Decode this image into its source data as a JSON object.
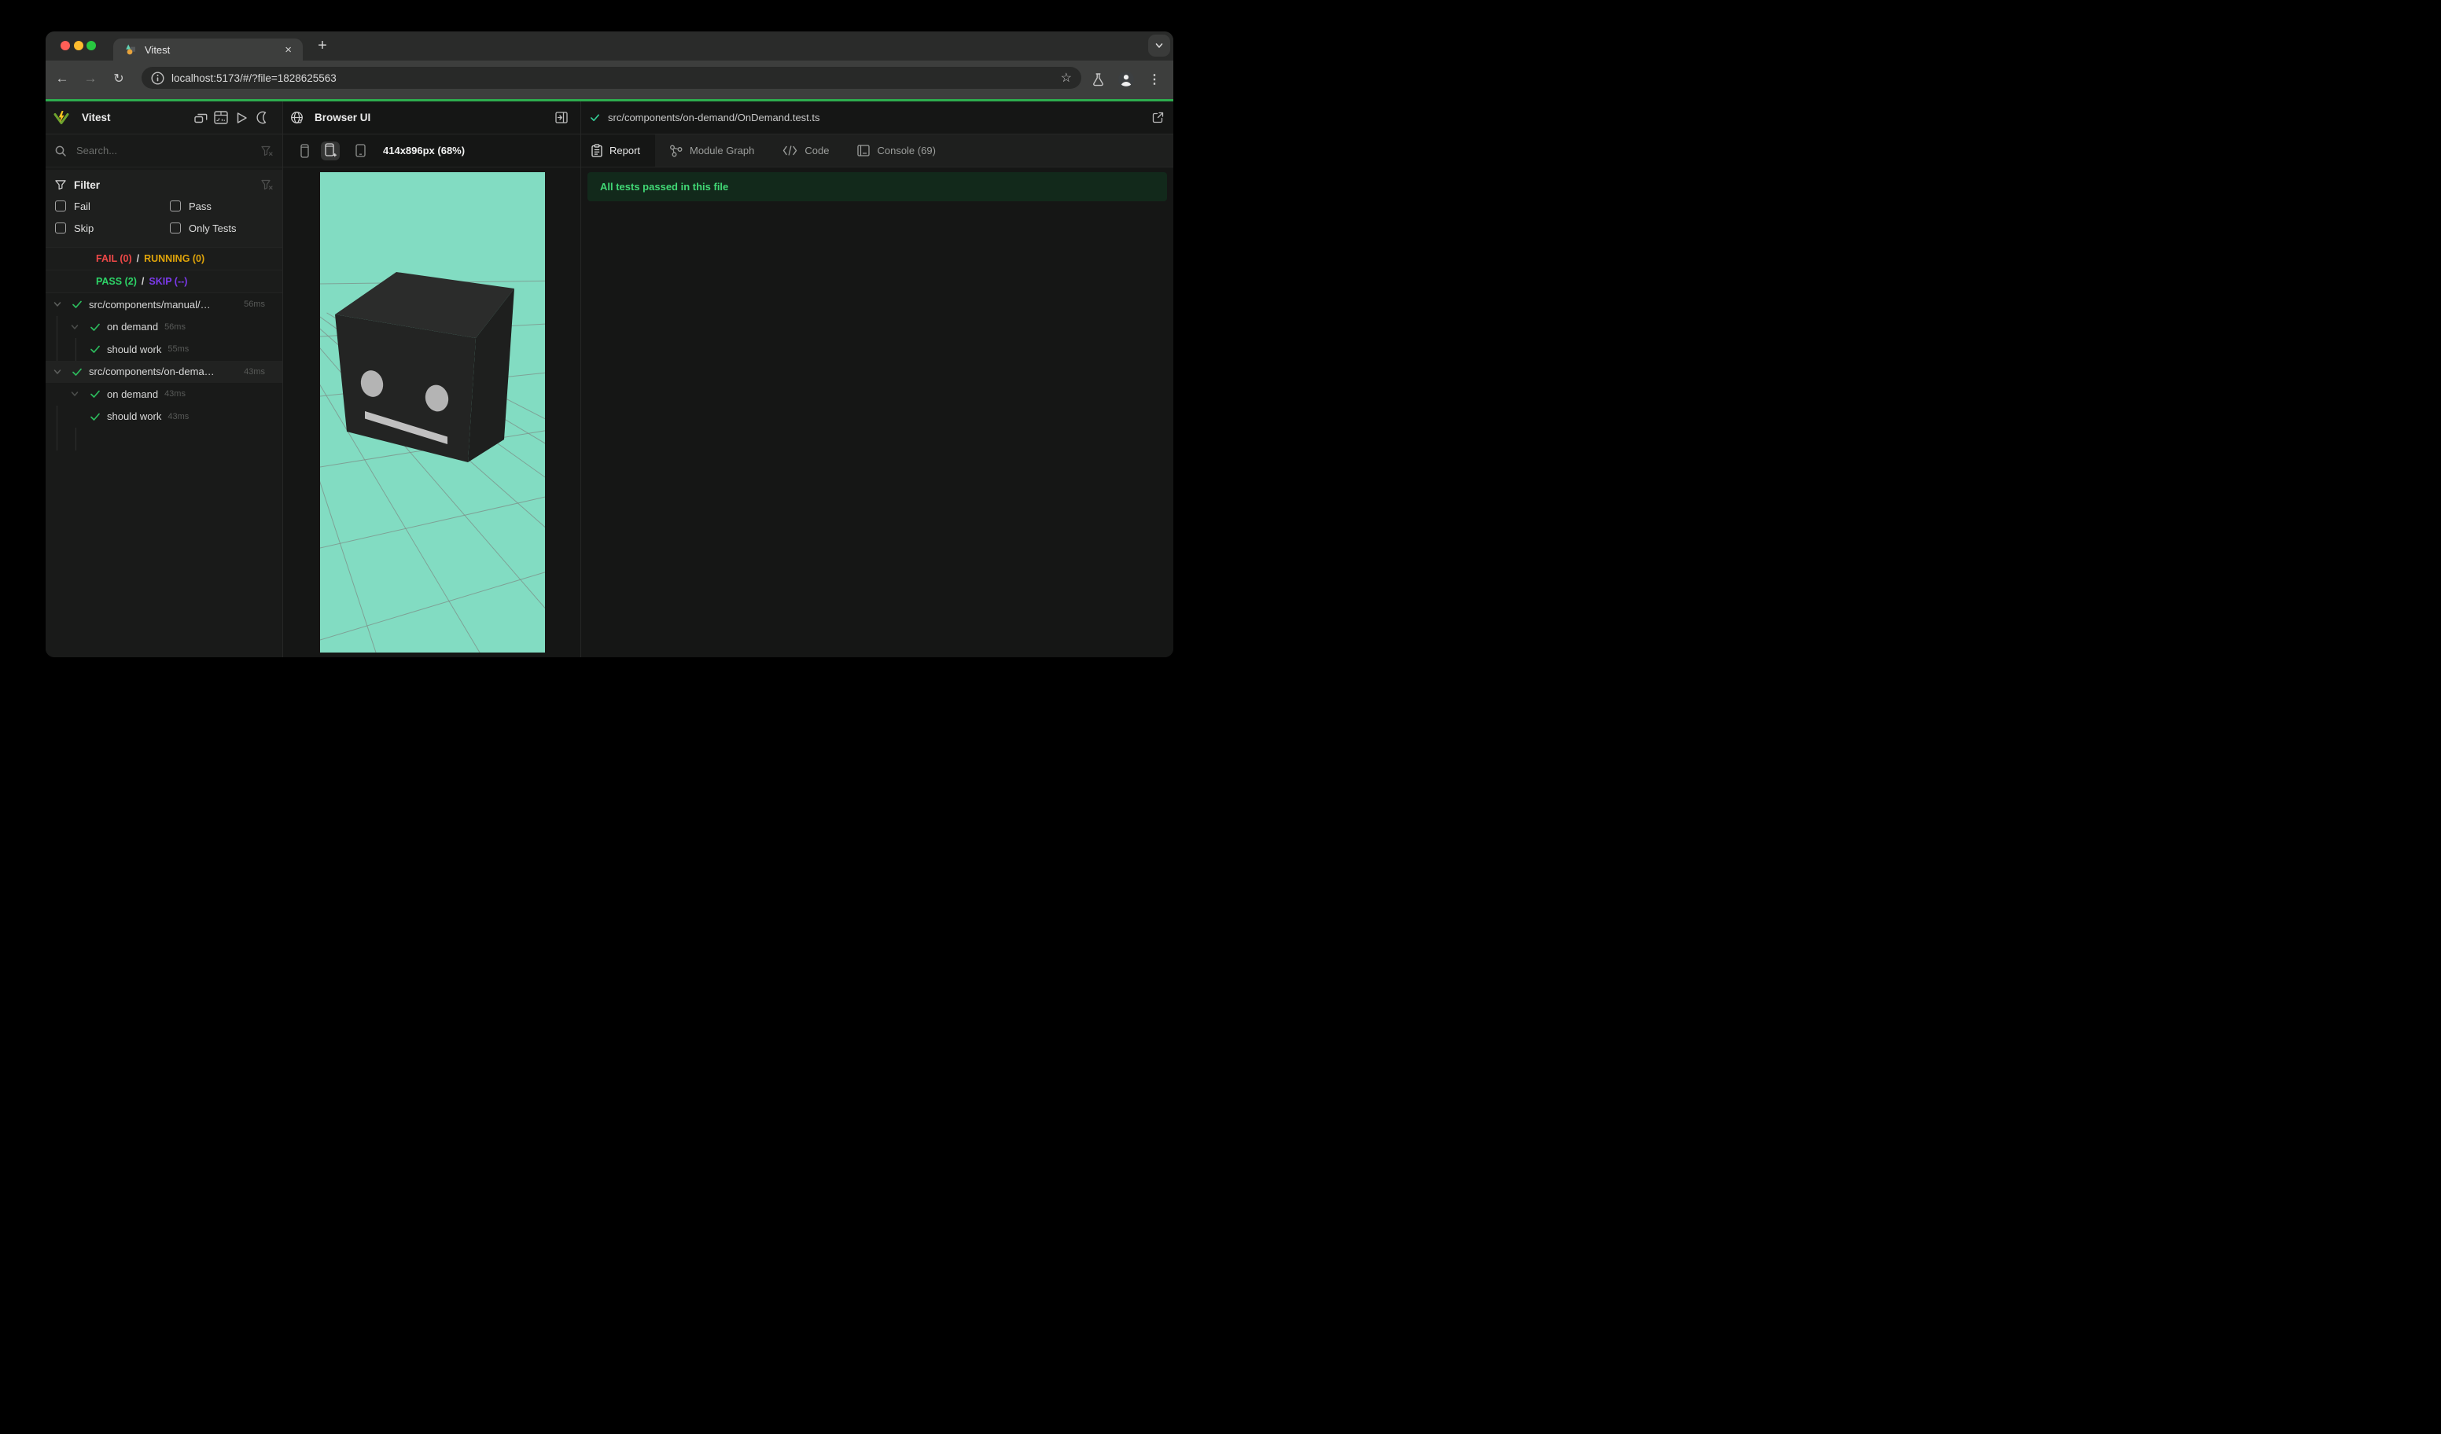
{
  "browser": {
    "tab_title": "Vitest",
    "url": "localhost:5173/#/?file=1828625563",
    "icons": {
      "back": "←",
      "forward": "→",
      "reload": "↻",
      "close": "×",
      "new_tab": "+",
      "menu": "⋮",
      "star": "☆"
    },
    "traffic_lights": [
      "#ff5f57",
      "#febc2e",
      "#28c840"
    ]
  },
  "sidebar": {
    "app_name": "Vitest",
    "search_placeholder": "Search...",
    "filter": {
      "title": "Filter",
      "options": [
        "Fail",
        "Pass",
        "Skip",
        "Only Tests"
      ]
    },
    "status": {
      "fail": "FAIL (0)",
      "running": "RUNNING (0)",
      "pass": "PASS (2)",
      "skip": "SKIP (--)",
      "sep": "/",
      "colors": {
        "fail": "#ef4848",
        "running": "#dfa40a",
        "pass": "#2dd467",
        "skip": "#7c3aed"
      }
    },
    "tree": [
      {
        "type": "file",
        "label": "src/components/manual/…",
        "duration": "56ms",
        "selected": false
      },
      {
        "type": "suite",
        "label": "on demand",
        "duration": "56ms",
        "selected": false
      },
      {
        "type": "test",
        "label": "should work",
        "duration": "55ms",
        "selected": false
      },
      {
        "type": "file",
        "label": "src/components/on-dema…",
        "duration": "43ms",
        "selected": true
      },
      {
        "type": "suite",
        "label": "on demand",
        "duration": "43ms",
        "selected": false
      },
      {
        "type": "test",
        "label": "should work",
        "duration": "43ms",
        "selected": false
      }
    ]
  },
  "preview": {
    "title": "Browser UI",
    "viewport_label": "414x896px (68%)",
    "scene": {
      "background": "#82dcc2",
      "grid_line": "#7d8a84",
      "cube_top": "#2b2c2b",
      "cube_front": "#232423",
      "cube_right": "#1e1f1e",
      "eye": "#b4b4b4",
      "mouth": "#c0c0c0"
    }
  },
  "results": {
    "file_path": "src/components/on-demand/OnDemand.test.ts",
    "tabs": [
      {
        "label": "Report",
        "active": true
      },
      {
        "label": "Module Graph",
        "active": false
      },
      {
        "label": "Code",
        "active": false
      },
      {
        "label": "Console (69)",
        "active": false
      }
    ],
    "banner": "All tests passed in this file",
    "banner_colors": {
      "bg": "#12291b",
      "text": "#41d875"
    }
  },
  "accent": {
    "progress_green": "#2dac4e"
  }
}
